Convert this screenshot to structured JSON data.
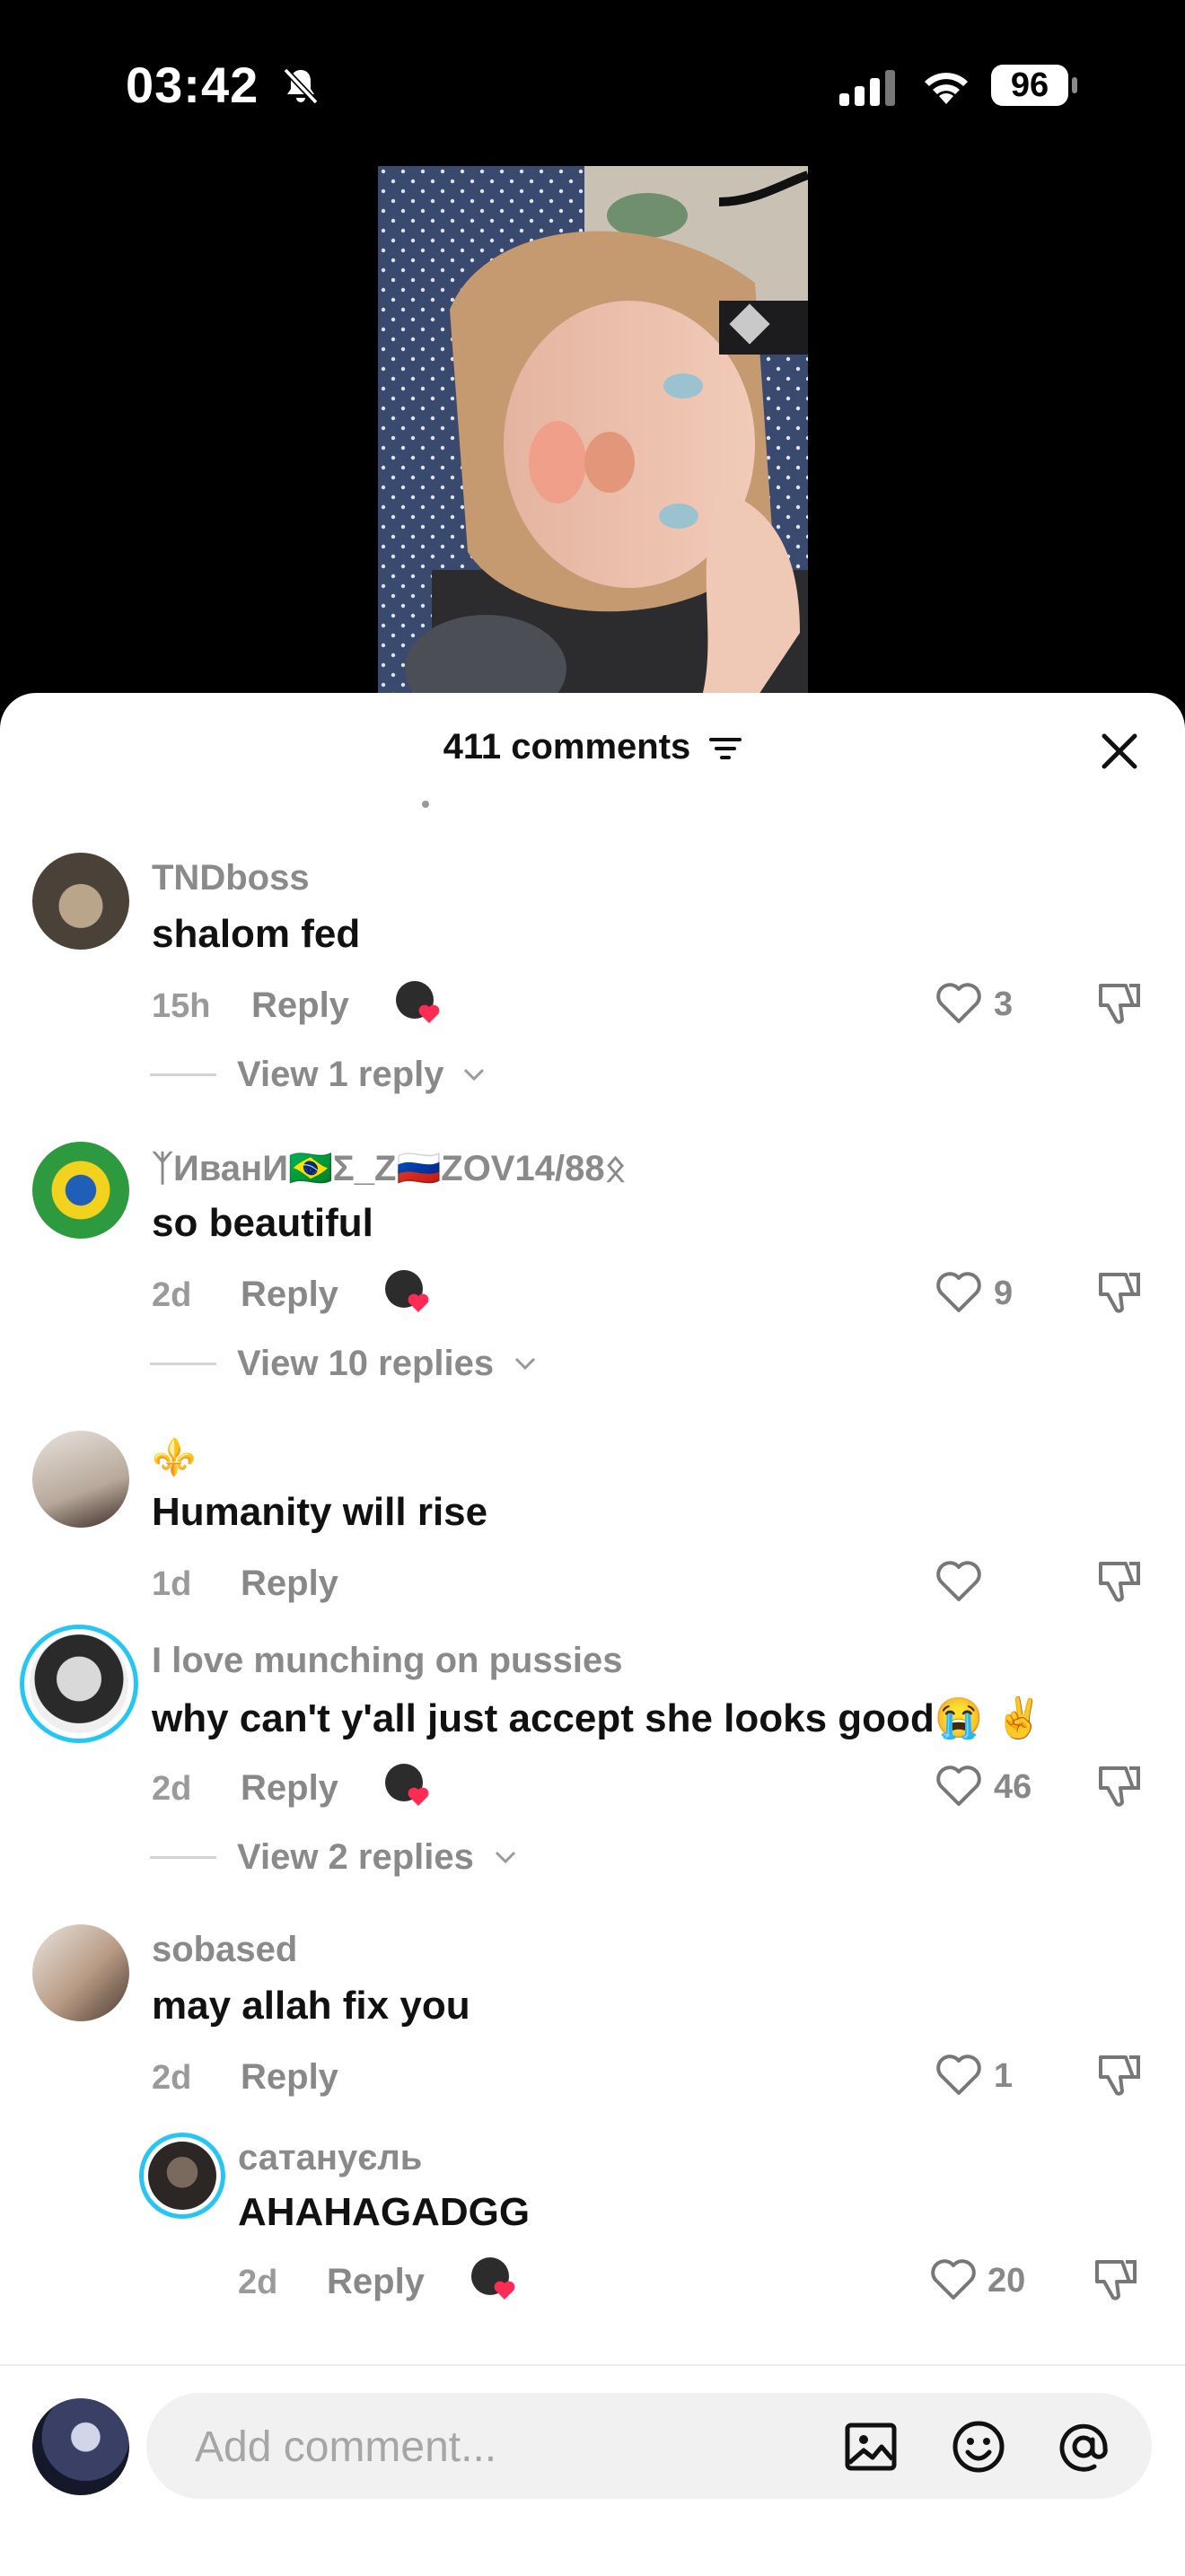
{
  "status_bar": {
    "time": "03:42",
    "battery": "96"
  },
  "sheet": {
    "comment_count": "411 comments"
  },
  "comments": [
    {
      "username": "TNDboss",
      "text": "shalom fed",
      "time": "15h",
      "reply": "Reply",
      "likes": "3",
      "view_replies": "View 1 reply"
    },
    {
      "username": "ᛉИванИ🇧🇷Σ_Z🇷🇺ZOV14/88ᛟ",
      "text": "so beautiful",
      "time": "2d",
      "reply": "Reply",
      "likes": "9",
      "view_replies": "View 10 replies"
    },
    {
      "username": "⚜️",
      "text": "Humanity will rise",
      "time": "1d",
      "reply": "Reply",
      "likes": ""
    },
    {
      "username": "I love munching on pussies",
      "text": "why can't y'all just accept she looks good😭 ✌️",
      "time": "2d",
      "reply": "Reply",
      "likes": "46",
      "view_replies": "View 2 replies"
    },
    {
      "username": "sobased",
      "text": "may allah fix you",
      "time": "2d",
      "reply": "Reply",
      "likes": "1"
    }
  ],
  "reply_item": {
    "username": "сатануєль",
    "text": "AHAHAGADGG",
    "time": "2d",
    "reply": "Reply",
    "likes": "20"
  },
  "composer": {
    "placeholder": "Add comment..."
  },
  "icons": {
    "like": "heart-outline-icon",
    "dislike": "thumbs-down-icon",
    "creator_liked": "creator-liked-heart-icon",
    "filter": "filter-icon",
    "close": "close-icon",
    "image": "image-icon",
    "emoji": "emoji-icon",
    "mention": "at-mention-icon"
  },
  "colors": {
    "liked_red": "#fe2c55",
    "ring_cyan": "#25f4ee"
  }
}
